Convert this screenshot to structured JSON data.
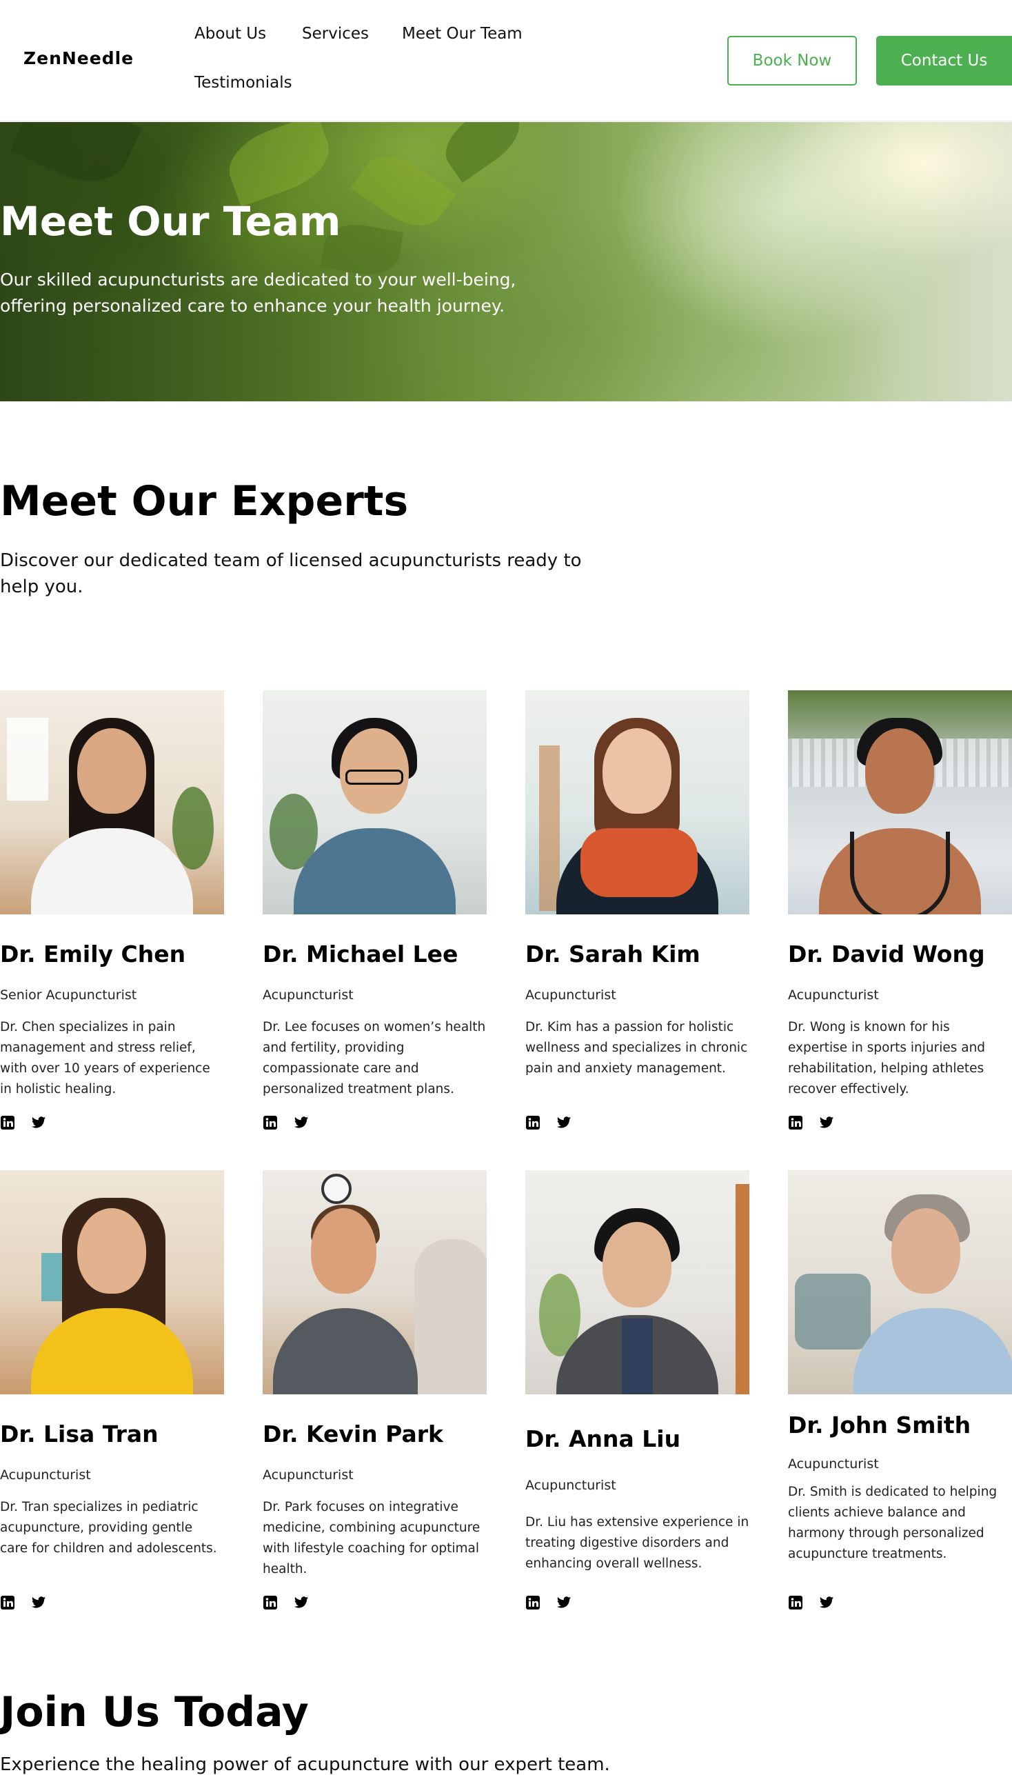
{
  "header": {
    "logo": "ZenNeedle",
    "nav": [
      "About Us",
      "Services",
      "Meet Our Team",
      "Testimonials"
    ],
    "book_label": "Book Now",
    "contact_label": "Contact Us"
  },
  "hero": {
    "title": "Meet Our Team",
    "subtitle": "Our skilled acupuncturists are dedicated to your well-being, offering personalized care to enhance your health journey."
  },
  "experts": {
    "title": "Meet Our Experts",
    "subtitle": "Discover our dedicated team of licensed acupuncturists ready to help you."
  },
  "team": [
    {
      "name": "Dr. Emily Chen",
      "role": "Senior Acupuncturist",
      "bio": "Dr. Chen specializes in pain management and stress relief, with over 10 years of experience in holistic healing."
    },
    {
      "name": "Dr. Michael Lee",
      "role": "Acupuncturist",
      "bio": "Dr. Lee focuses on women’s health and fertility, providing compassionate care and personalized treatment plans."
    },
    {
      "name": "Dr. Sarah Kim",
      "role": "Acupuncturist",
      "bio": "Dr. Kim has a passion for holistic wellness and specializes in chronic pain and anxiety management."
    },
    {
      "name": "Dr. David Wong",
      "role": "Acupuncturist",
      "bio": "Dr. Wong is known for his expertise in sports injuries and rehabilitation, helping athletes recover effectively."
    },
    {
      "name": "Dr. Lisa Tran",
      "role": "Acupuncturist",
      "bio": "Dr. Tran specializes in pediatric acupuncture, providing gentle care for children and adolescents."
    },
    {
      "name": "Dr. Kevin Park",
      "role": "Acupuncturist",
      "bio": "Dr. Park focuses on integrative medicine, combining acupuncture with lifestyle coaching for optimal health."
    },
    {
      "name": "Dr. Anna Liu",
      "role": "Acupuncturist",
      "bio": "Dr. Liu has extensive experience in treating digestive disorders and enhancing overall wellness."
    },
    {
      "name": "Dr. John Smith",
      "role": "Acupuncturist",
      "bio": "Dr. Smith is dedicated to helping clients achieve balance and harmony through personalized acupuncture treatments."
    }
  ],
  "social_icons": [
    "linkedin-icon",
    "twitter-icon"
  ],
  "join": {
    "title": "Join Us Today",
    "subtitle": "Experience the healing power of acupuncture with our expert team."
  },
  "colors": {
    "accent": "#4caf50",
    "text": "#000000",
    "background": "#ffffff"
  }
}
